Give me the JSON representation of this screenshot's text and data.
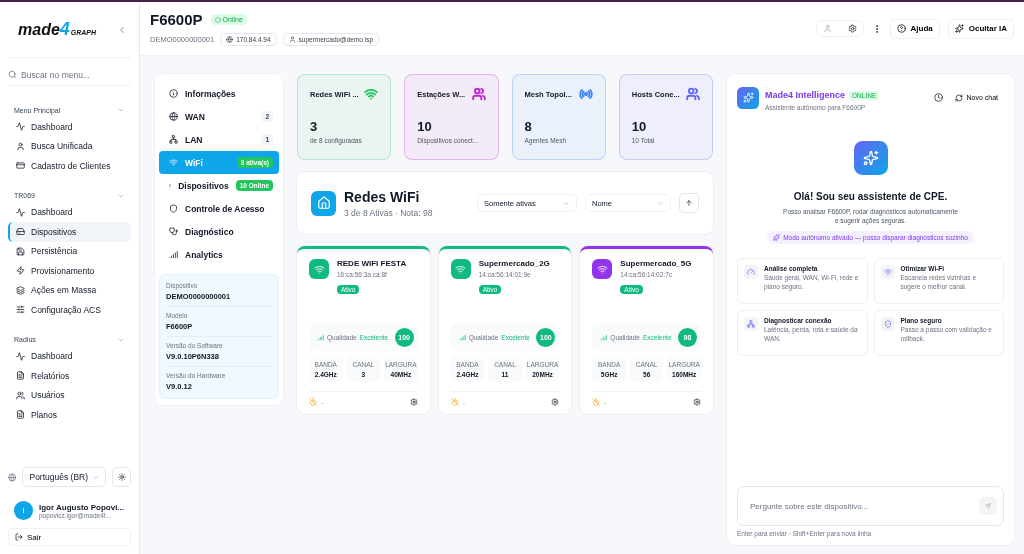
{
  "sidebar": {
    "logo": {
      "word": "made",
      "digit": "4",
      "sub": "GRAPH"
    },
    "search": {
      "placeholder": "Buscar no menu..."
    },
    "sections": [
      {
        "title": "Menu Principal",
        "items": [
          {
            "label": "Dashboard",
            "selected": false
          },
          {
            "label": "Busca Unificada",
            "selected": false
          },
          {
            "label": "Cadastro de Clientes",
            "selected": false
          }
        ]
      },
      {
        "title": "TR069",
        "items": [
          {
            "label": "Dashboard",
            "selected": false
          },
          {
            "label": "Dispositivos",
            "selected": true
          },
          {
            "label": "Persistência",
            "selected": false
          },
          {
            "label": "Provisionamento",
            "selected": false
          },
          {
            "label": "Ações em Massa",
            "selected": false
          },
          {
            "label": "Configuração ACS",
            "selected": false
          }
        ]
      },
      {
        "title": "Radius",
        "items": [
          {
            "label": "Dashboard",
            "selected": false
          },
          {
            "label": "Relatórios",
            "selected": false
          },
          {
            "label": "Usuários",
            "selected": false
          },
          {
            "label": "Planos",
            "selected": false
          }
        ]
      }
    ],
    "language": "Português (BR)",
    "user": {
      "initial": "I",
      "name": "Igor Augusto Popovi...",
      "email": "popovicz.igor@made4t..."
    },
    "logout": "Sair"
  },
  "device": {
    "title": "F6600P",
    "status": "Online",
    "serial": "DEMO0000000001",
    "ip": "170.84.4.94",
    "email": "supermercado@demo.isp"
  },
  "toolbar": {
    "help": "Ajuda",
    "hide_ai": "Ocultar IA"
  },
  "device_nav": [
    {
      "label": "Informações",
      "selected": false
    },
    {
      "label": "WAN",
      "selected": false,
      "badge": {
        "kind": "count",
        "text": "2"
      }
    },
    {
      "label": "LAN",
      "selected": false,
      "badge": {
        "kind": "count",
        "text": "1"
      }
    },
    {
      "label": "WiFi",
      "selected": true,
      "badge": {
        "kind": "status",
        "text": "3 ativa(s)"
      }
    },
    {
      "label": "Dispositivos",
      "selected": false,
      "badge": {
        "kind": "status",
        "text": "10 Online"
      }
    },
    {
      "label": "Controle de Acesso",
      "selected": false
    },
    {
      "label": "Diagnóstico",
      "selected": false
    },
    {
      "label": "Analytics",
      "selected": false
    }
  ],
  "device_info": [
    {
      "label": "Dispositivo",
      "value": "DEMO0000000001"
    },
    {
      "label": "Modelo",
      "value": "F6600P"
    },
    {
      "label": "Versão do Software",
      "value": "V9.0.10P6N338"
    },
    {
      "label": "Versão do Hardware",
      "value": "V9.0.12"
    }
  ],
  "stats": [
    {
      "title": "Redes WiFi ...",
      "value": "3",
      "sub": "de 8 configuradas",
      "color": "#22c55e"
    },
    {
      "title": "Estações W...",
      "value": "10",
      "sub": "Dispositivos conect...",
      "color": "#c026d3"
    },
    {
      "title": "Mesh Topol...",
      "value": "8",
      "sub": "Agentes Mesh",
      "color": "#3b82f6"
    },
    {
      "title": "Hosts Cone...",
      "value": "10",
      "sub": "10 Total",
      "color": "#6366f1"
    }
  ],
  "networks_panel": {
    "title": "Redes WiFi",
    "subtitle": "3 de 8 Ativas · Nota: 98",
    "filter": "Somente ativas",
    "sort": "Nome"
  },
  "networks": [
    {
      "name": "REDE WIFI FESTA",
      "mac": "16:ca:56:3a:ca:8f",
      "status": "Ativo",
      "color": "#10b981",
      "quality_label": "Qualidade",
      "quality": "Excelente",
      "score": "100",
      "specs": [
        {
          "label": "BANDA",
          "value": "2.4GHz"
        },
        {
          "label": "CANAL",
          "value": "3"
        },
        {
          "label": "LARGURA",
          "value": "40MHz"
        }
      ],
      "footer": "-"
    },
    {
      "name": "Supermercado_2G",
      "mac": "14:ca:56:14:01:9e",
      "status": "Ativo",
      "color": "#10b981",
      "quality_label": "Qualidade",
      "quality": "Excelente",
      "score": "100",
      "specs": [
        {
          "label": "BANDA",
          "value": "2.4GHz"
        },
        {
          "label": "CANAL",
          "value": "11"
        },
        {
          "label": "LARGURA",
          "value": "20MHz"
        }
      ],
      "footer": "-"
    },
    {
      "name": "Supermercado_5G",
      "mac": "14:ca:56:14:02:7c",
      "status": "Ativo",
      "color": "#9333ea",
      "quality_label": "Qualidade",
      "quality": "Excelente",
      "score": "98",
      "specs": [
        {
          "label": "BANDA",
          "value": "5GHz"
        },
        {
          "label": "CANAL",
          "value": "56"
        },
        {
          "label": "LARGURA",
          "value": "160MHz"
        }
      ],
      "footer": "-"
    }
  ],
  "assistant": {
    "title": "Made4 Intelligence",
    "badge": "ONLINE",
    "subtitle": "Assistente autônomo para F6600P",
    "new_chat": "Novo chat",
    "greeting": "Olá! Sou seu assistente de CPE.",
    "intro": "Posso analisar F6600P, rodar diagnósticos automaticamente e sugerir ações seguras.",
    "mode": "Modo autônomo ativado — posso disparar diagnósticos sozinho",
    "suggestions": [
      {
        "title": "Análise completa",
        "text": "Saúde geral, WAN, Wi-Fi, rede e plano seguro."
      },
      {
        "title": "Otimizar Wi-Fi",
        "text": "Escaneia redes vizinhas e sugere o melhor canal."
      },
      {
        "title": "Diagnosticar conexão",
        "text": "Latência, perda, rota e saúde da WAN."
      },
      {
        "title": "Plano seguro",
        "text": "Passo a passo com validação e rollback."
      }
    ],
    "input": {
      "placeholder": "Pergunte sobre este dispositivo..."
    },
    "hint": "Enter para enviar · Shift+Enter para nova linha"
  }
}
